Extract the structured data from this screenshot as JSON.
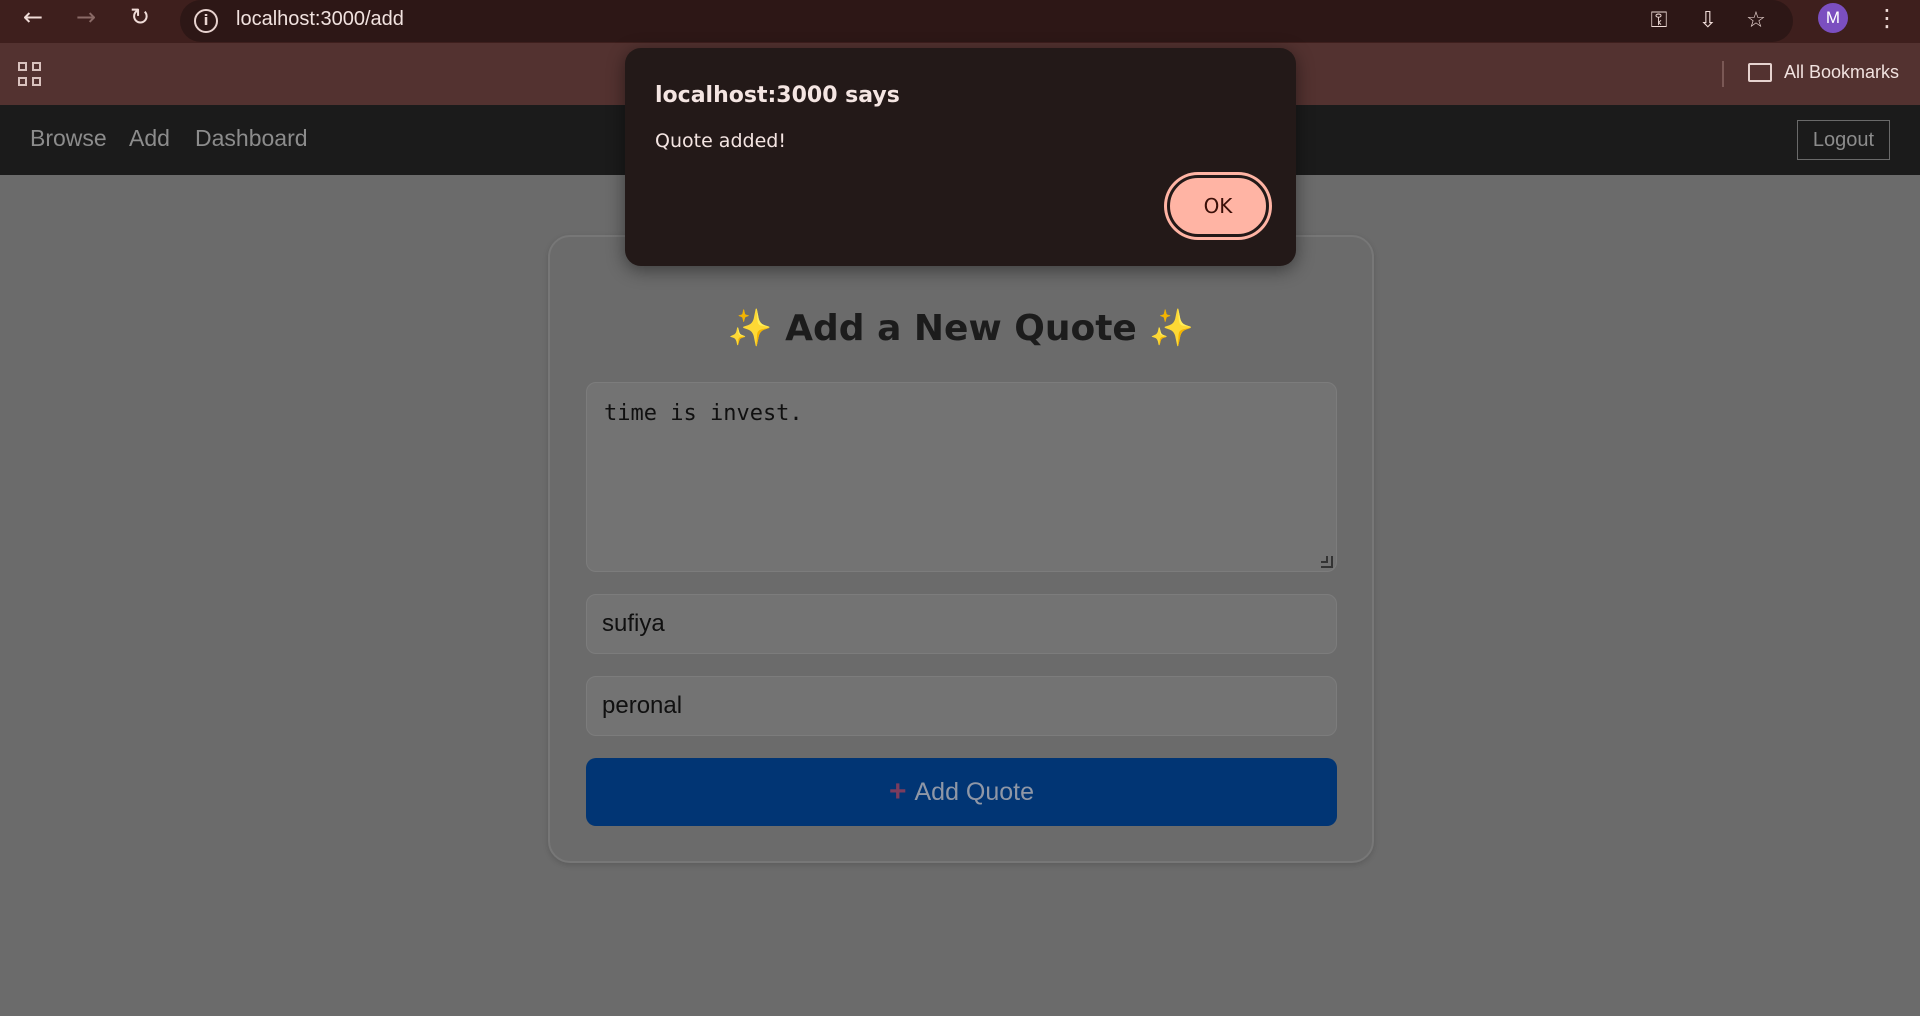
{
  "browser": {
    "url": "localhost:3000/add",
    "bookmarks_label": "All Bookmarks",
    "avatar_letter": "M",
    "accent": "#3e1f1d"
  },
  "app_nav": {
    "links": [
      "Browse",
      "Add",
      "Dashboard"
    ],
    "logout_label": "Logout"
  },
  "form": {
    "title": "Add a New Quote",
    "sparkle": "✨",
    "quote_text": "time is invest.",
    "author_value": "sufiya",
    "category_value": "peronal",
    "submit_label": "Add Quote",
    "submit_icon": "+",
    "submit_color": "#013574"
  },
  "dialog": {
    "title": "localhost:3000 says",
    "message": "Quote added!",
    "ok_label": "OK",
    "ok_color": "#ffb4a4"
  }
}
